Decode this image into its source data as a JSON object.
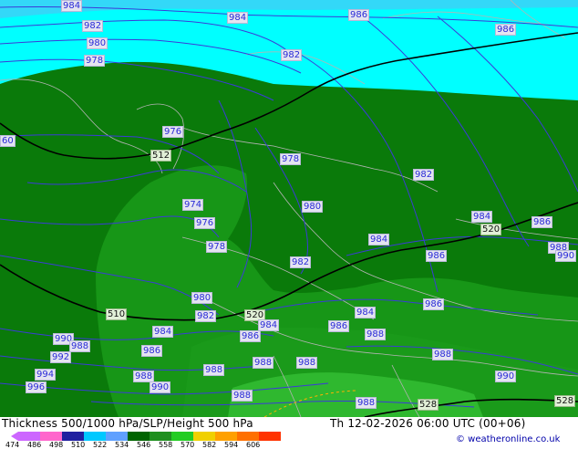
{
  "map": {
    "isobar_labels": [
      {
        "text": "984",
        "kind": "isobar"
      },
      {
        "text": "982",
        "kind": "isobar"
      },
      {
        "text": "980",
        "kind": "isobar"
      },
      {
        "text": "978",
        "kind": "isobar"
      },
      {
        "text": "984",
        "kind": "isobar"
      },
      {
        "text": "986",
        "kind": "isobar"
      },
      {
        "text": "982",
        "kind": "isobar"
      },
      {
        "text": "986",
        "kind": "isobar"
      },
      {
        "text": "976",
        "kind": "isobar"
      },
      {
        "text": "512",
        "kind": "thickness"
      },
      {
        "text": "978",
        "kind": "isobar"
      },
      {
        "text": "982",
        "kind": "isobar"
      },
      {
        "text": "974",
        "kind": "isobar"
      },
      {
        "text": "980",
        "kind": "isobar"
      },
      {
        "text": "976",
        "kind": "isobar"
      },
      {
        "text": "984",
        "kind": "isobar"
      },
      {
        "text": "986",
        "kind": "isobar"
      },
      {
        "text": "520",
        "kind": "thickness"
      },
      {
        "text": "978",
        "kind": "isobar"
      },
      {
        "text": "984",
        "kind": "isobar"
      },
      {
        "text": "986",
        "kind": "isobar"
      },
      {
        "text": "988",
        "kind": "isobar"
      },
      {
        "text": "990",
        "kind": "isobar"
      },
      {
        "text": "982",
        "kind": "isobar"
      },
      {
        "text": "980",
        "kind": "isobar"
      },
      {
        "text": "986",
        "kind": "isobar"
      },
      {
        "text": "510",
        "kind": "thickness"
      },
      {
        "text": "982",
        "kind": "isobar"
      },
      {
        "text": "520",
        "kind": "thickness"
      },
      {
        "text": "984",
        "kind": "isobar"
      },
      {
        "text": "984",
        "kind": "isobar"
      },
      {
        "text": "986",
        "kind": "isobar"
      },
      {
        "text": "988",
        "kind": "isobar"
      },
      {
        "text": "984",
        "kind": "isobar"
      },
      {
        "text": "986",
        "kind": "isobar"
      },
      {
        "text": "990",
        "kind": "isobar"
      },
      {
        "text": "988",
        "kind": "isobar"
      },
      {
        "text": "992",
        "kind": "isobar"
      },
      {
        "text": "986",
        "kind": "isobar"
      },
      {
        "text": "988",
        "kind": "isobar"
      },
      {
        "text": "988",
        "kind": "isobar"
      },
      {
        "text": "988",
        "kind": "isobar"
      },
      {
        "text": "994",
        "kind": "isobar"
      },
      {
        "text": "988",
        "kind": "isobar"
      },
      {
        "text": "996",
        "kind": "isobar"
      },
      {
        "text": "990",
        "kind": "isobar"
      },
      {
        "text": "988",
        "kind": "isobar"
      },
      {
        "text": "990",
        "kind": "isobar"
      },
      {
        "text": "988",
        "kind": "isobar"
      },
      {
        "text": "528",
        "kind": "thickness"
      },
      {
        "text": "528",
        "kind": "thickness"
      },
      {
        "text": "988",
        "kind": "isobar"
      },
      {
        "text": "60",
        "kind": "isobar"
      }
    ],
    "colors": {
      "thickness_474": "#cc66ff",
      "thickness_486": "#ff66cc",
      "thickness_498": "#2020a0",
      "thickness_510": "#00c8ff",
      "thickness_522": "#60a0ff",
      "thickness_534": "#006400",
      "thickness_546": "#1f8f1f",
      "thickness_558": "#22cc22",
      "thickness_570": "#f0d000",
      "thickness_582": "#ffa000",
      "thickness_594": "#ff7000",
      "thickness_606": "#ff3300",
      "sea_cyan": "#00ffff",
      "isobar_line": "#3b3bd8",
      "thickness_line": "#000000",
      "border_line": "#b4b4b4"
    }
  },
  "footer": {
    "title": "Thickness 500/1000 hPa/SLP/Height 500 hPa",
    "date": "Th 12-02-2026 06:00 UTC (00+06)",
    "credit": "© weatheronline.co.uk",
    "scale_ticks": [
      "474",
      "486",
      "498",
      "510",
      "522",
      "534",
      "546",
      "558",
      "570",
      "582",
      "594",
      "606"
    ],
    "scale_colors": [
      "#cc66ff",
      "#ff66cc",
      "#2020a0",
      "#00c8ff",
      "#60a0ff",
      "#006400",
      "#1f8f1f",
      "#22cc22",
      "#f0d000",
      "#ffa000",
      "#ff7000",
      "#ff3300"
    ]
  }
}
